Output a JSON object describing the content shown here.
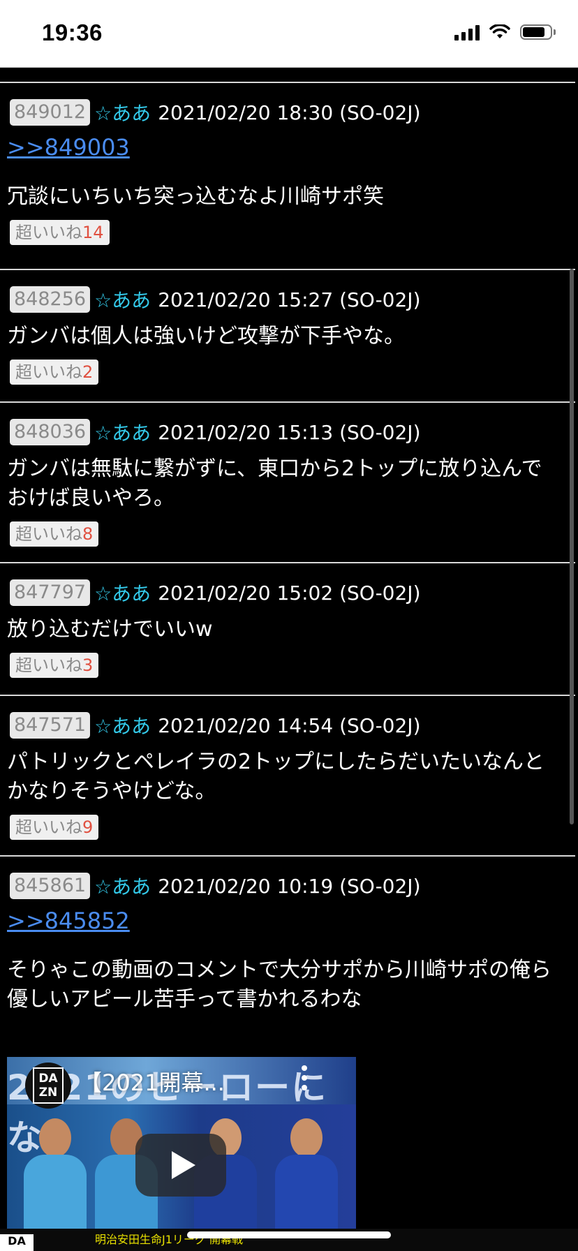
{
  "status_bar": {
    "time": "19:36"
  },
  "posts": [
    {
      "number": "849012",
      "name": "☆ああ",
      "meta": "2021/02/20 18:30 (SO-02J)",
      "reply": ">>849003",
      "body": "冗談にいちいち突っ込むなよ川崎サポ笑",
      "like_label": "超いいね",
      "like_count": "14"
    },
    {
      "number": "848256",
      "name": "☆ああ",
      "meta": "2021/02/20 15:27 (SO-02J)",
      "body": "ガンバは個人は強いけど攻撃が下手やな。",
      "like_label": "超いいね",
      "like_count": "2"
    },
    {
      "number": "848036",
      "name": "☆ああ",
      "meta": "2021/02/20 15:13 (SO-02J)",
      "body": "ガンバは無駄に繋がずに、東口から2トップに放り込んでおけば良いやろ。",
      "like_label": "超いいね",
      "like_count": "8"
    },
    {
      "number": "847797",
      "name": "☆ああ",
      "meta": "2021/02/20 15:02 (SO-02J)",
      "body": "放り込むだけでいいw",
      "like_label": "超いいね",
      "like_count": "3"
    },
    {
      "number": "847571",
      "name": "☆ああ",
      "meta": "2021/02/20 14:54 (SO-02J)",
      "body": "パトリックとペレイラの2トップにしたらだいたいなんとかなりそうやけどな。",
      "like_label": "超いいね",
      "like_count": "9"
    },
    {
      "number": "845861",
      "name": "☆ああ",
      "meta": "2021/02/20 10:19 (SO-02J)",
      "reply": ">>845852",
      "body": "そりゃこの動画のコメントで大分サポから川崎サポの俺ら優しいアピール苦手って書かれるわな"
    }
  ],
  "video": {
    "logo_text": "DA ZN",
    "title": "【2021開幕...",
    "banner_text": "2021のヒーローにな",
    "bottom_text": "明治安田生命J1リーグ 開幕戦"
  },
  "colors": {
    "background": "#000000",
    "name": "#33c8e8",
    "link": "#4a8cf0",
    "like_count": "#e05040"
  }
}
